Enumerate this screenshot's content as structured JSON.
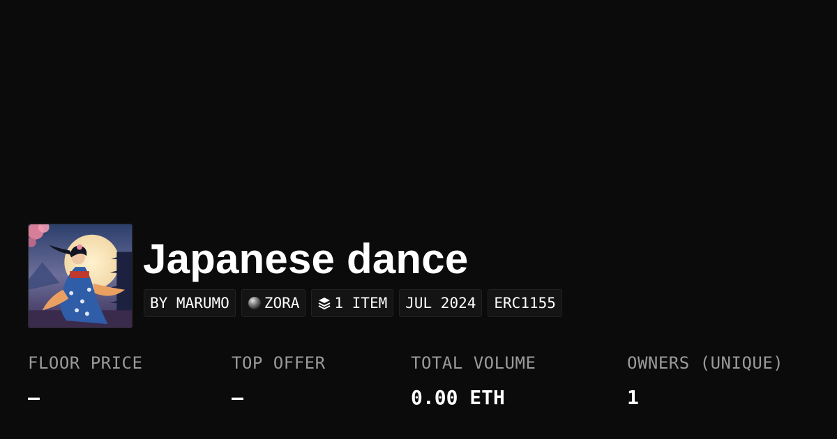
{
  "collection": {
    "title": "Japanese dance",
    "image_alt": "Japanese dance collection artwork"
  },
  "tags": [
    {
      "label": "BY MARUMO",
      "icon": ""
    },
    {
      "label": "ZORA",
      "icon": "zora-orb-icon"
    },
    {
      "label": "1 ITEM",
      "icon": "layers-icon"
    },
    {
      "label": "JUL 2024",
      "icon": ""
    },
    {
      "label": "ERC1155",
      "icon": ""
    }
  ],
  "stats": {
    "floor_price": {
      "label": "FLOOR PRICE",
      "value": "–"
    },
    "top_offer": {
      "label": "TOP OFFER",
      "value": "–"
    },
    "total_volume": {
      "label": "TOTAL VOLUME",
      "value": "0.00 ETH"
    },
    "owners": {
      "label": "OWNERS (UNIQUE)",
      "value": "1"
    }
  },
  "colors": {
    "background": "#0b0b0b",
    "text": "#ffffff",
    "label": "#9a9a9a",
    "tag_bg": "#141414"
  }
}
